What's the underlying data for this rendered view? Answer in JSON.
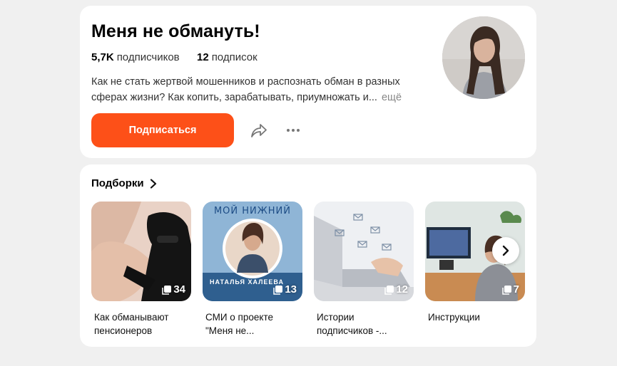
{
  "channel": {
    "title": "Меня не обмануть!",
    "subscribers_count": "5,7K",
    "subscribers_label": "подписчиков",
    "subscriptions_count": "12",
    "subscriptions_label": "подписок",
    "description": "Как не стать жертвой мошенников и распознать обман в разных сферах жизни? Как копить, зарабатывать, приумножать и...",
    "more_label": "ещё",
    "subscribe_label": "Подписаться",
    "accent_color": "#fd5018"
  },
  "collections": {
    "title": "Подборки",
    "items": [
      {
        "label": "Как обманывают пенсионеров",
        "count": "34"
      },
      {
        "label": "СМИ о проекте \"Меня не...",
        "count": "13",
        "banner_top": "МОЙ НИЖНИЙ",
        "banner_bottom": "НАТАЛЬЯ ХАЛЕЕВА"
      },
      {
        "label": "Истории подписчиков -...",
        "count": "12"
      },
      {
        "label": "Инструкции",
        "count": "7"
      }
    ]
  }
}
